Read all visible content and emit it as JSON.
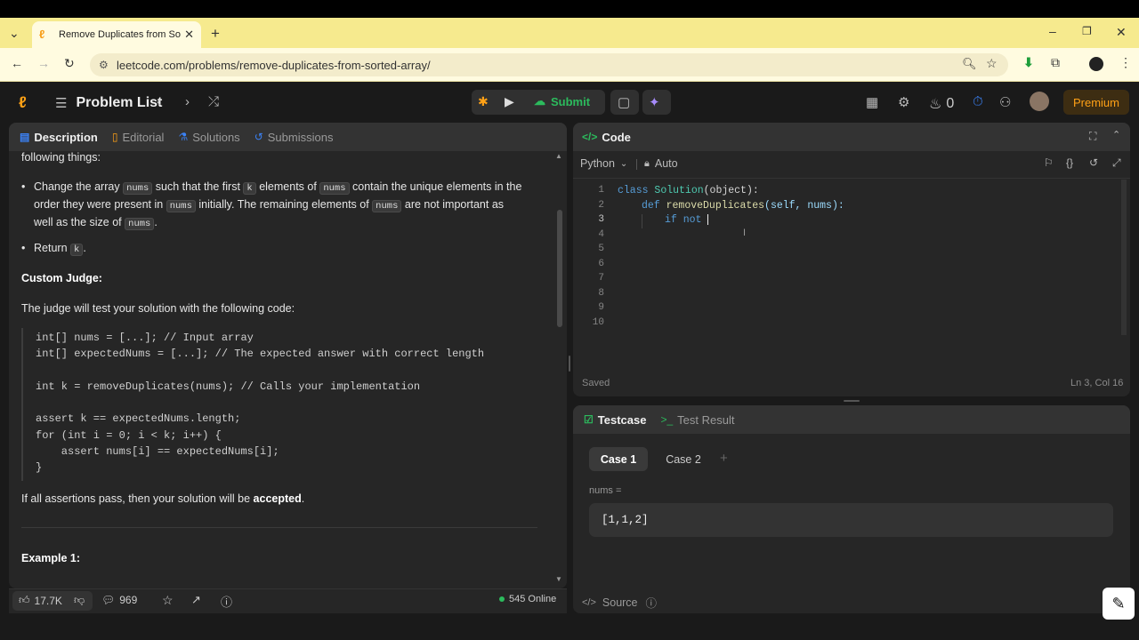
{
  "browser": {
    "tab_title": "Remove Duplicates from Sorted Array",
    "url": "leetcode.com/problems/remove-duplicates-from-sorted-array/"
  },
  "nav": {
    "problem_list": "Problem List",
    "submit": "Submit",
    "streak_count": "0",
    "premium": "Premium"
  },
  "left_panel": {
    "tabs": [
      "Description",
      "Editorial",
      "Solutions",
      "Submissions"
    ],
    "intro": "following things:",
    "bullet1_parts": [
      "Change the array ",
      "nums",
      " such that the first ",
      "k",
      " elements of ",
      "nums",
      " contain the unique elements in the"
    ],
    "bullet1_line2_parts": [
      "order they were present in ",
      "nums",
      " initially. The remaining elements of ",
      "nums",
      " are not important as"
    ],
    "bullet1_line3_parts": [
      "well as the size of ",
      "nums",
      "."
    ],
    "bullet2_parts": [
      "Return ",
      "k",
      "."
    ],
    "custom_judge_heading": "Custom Judge:",
    "judge_text": "The judge will test your solution with the following code:",
    "judge_code": [
      "int[] nums = [...]; // Input array",
      "int[] expectedNums = [...]; // The expected answer with correct length",
      "",
      "int k = removeDuplicates(nums); // Calls your implementation",
      "",
      "assert k == expectedNums.length;",
      "for (int i = 0; i < k; i++) {",
      "    assert nums[i] == expectedNums[i];",
      "}"
    ],
    "assert_text_before": "If all assertions pass, then your solution will be ",
    "assert_text_bold": "accepted",
    "assert_text_after": ".",
    "example_heading": "Example 1:",
    "likes": "17.7K",
    "comments": "969",
    "online": "545 Online"
  },
  "code_panel": {
    "title": "Code",
    "language": "Python",
    "auto_label": "Auto",
    "line_numbers": [
      "1",
      "2",
      "3",
      "4",
      "5",
      "6",
      "7",
      "8",
      "9",
      "10"
    ],
    "line1": {
      "kw": "class",
      "name": "Solution",
      "rest": "(object):"
    },
    "line2": {
      "kw": "def",
      "name": "removeDuplicates",
      "rest": "(self, nums):"
    },
    "line3": {
      "kw": "if",
      "rest": " not "
    },
    "saved": "Saved",
    "cursor_pos": "Ln 3, Col 16"
  },
  "testcase_panel": {
    "tabs": [
      "Testcase",
      "Test Result"
    ],
    "cases": [
      "Case 1",
      "Case 2"
    ],
    "param_label": "nums =",
    "param_value": "[1,1,2]",
    "source": "Source"
  }
}
